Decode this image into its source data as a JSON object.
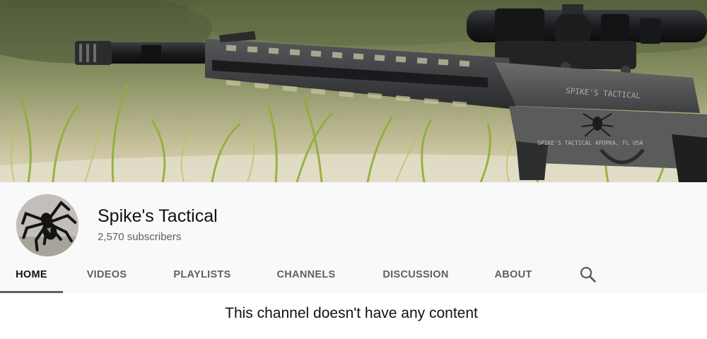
{
  "channel": {
    "name": "Spike's Tactical",
    "subscribers": "2,570 subscribers"
  },
  "banner": {
    "engraving_brand": "SPIKE'S TACTICAL",
    "engraving_location": "SPIKE'S TACTICAL APOPKA, FL USA"
  },
  "tabs": {
    "home": "HOME",
    "videos": "VIDEOS",
    "playlists": "PLAYLISTS",
    "channels": "CHANNELS",
    "discussion": "DISCUSSION",
    "about": "ABOUT",
    "active": "home"
  },
  "icons": {
    "search": "search-icon"
  },
  "colors": {
    "header_bg": "#f9f9f9",
    "tab_text": "#606060",
    "tab_active_text": "#111111",
    "subscriber_text": "#606060"
  },
  "content": {
    "empty_message": "This channel doesn't have any content"
  }
}
